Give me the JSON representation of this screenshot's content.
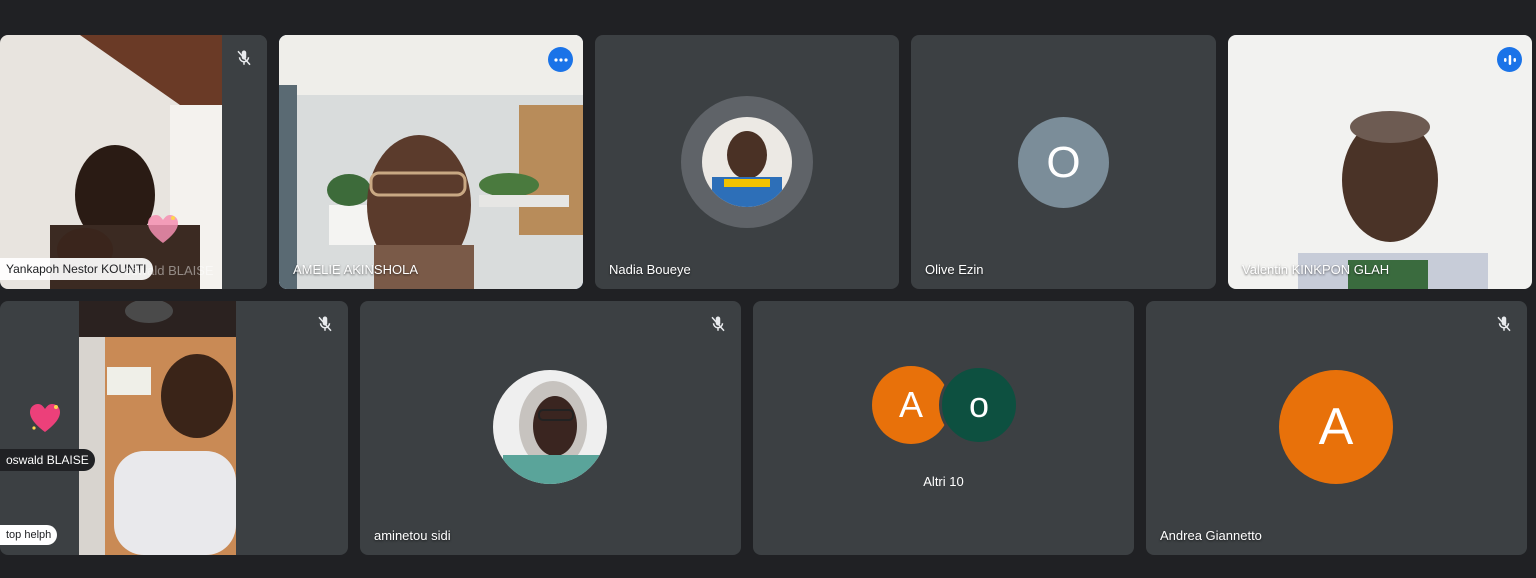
{
  "tiles": [
    {
      "name": "Yankapoh Nestor KOUNTI",
      "overlay_name": "oswald BLAISE"
    },
    {
      "name": "AMELIE AKINSHOLA"
    },
    {
      "name": "Nadia Boueye"
    },
    {
      "name": "Olive Ezin",
      "initial": "O"
    },
    {
      "name": "Valentin KINKPON GLAH"
    },
    {
      "name": "oswald BLAISE",
      "pill": "top helph"
    },
    {
      "name": "aminetou sidi"
    },
    {
      "name": "Altri 10",
      "initials": [
        "A",
        "o"
      ]
    },
    {
      "name": "Andrea Giannetto",
      "initial": "A"
    }
  ],
  "colors": {
    "background": "#202124",
    "tile": "#3c4043",
    "accent": "#1a73e8",
    "avatar_orange": "#e8710a",
    "avatar_green": "#0d5040",
    "avatar_slate": "#7b8d99"
  },
  "icons": [
    "mic-off-icon",
    "more-options-icon",
    "speaking-icon",
    "sparkling-heart-icon"
  ]
}
